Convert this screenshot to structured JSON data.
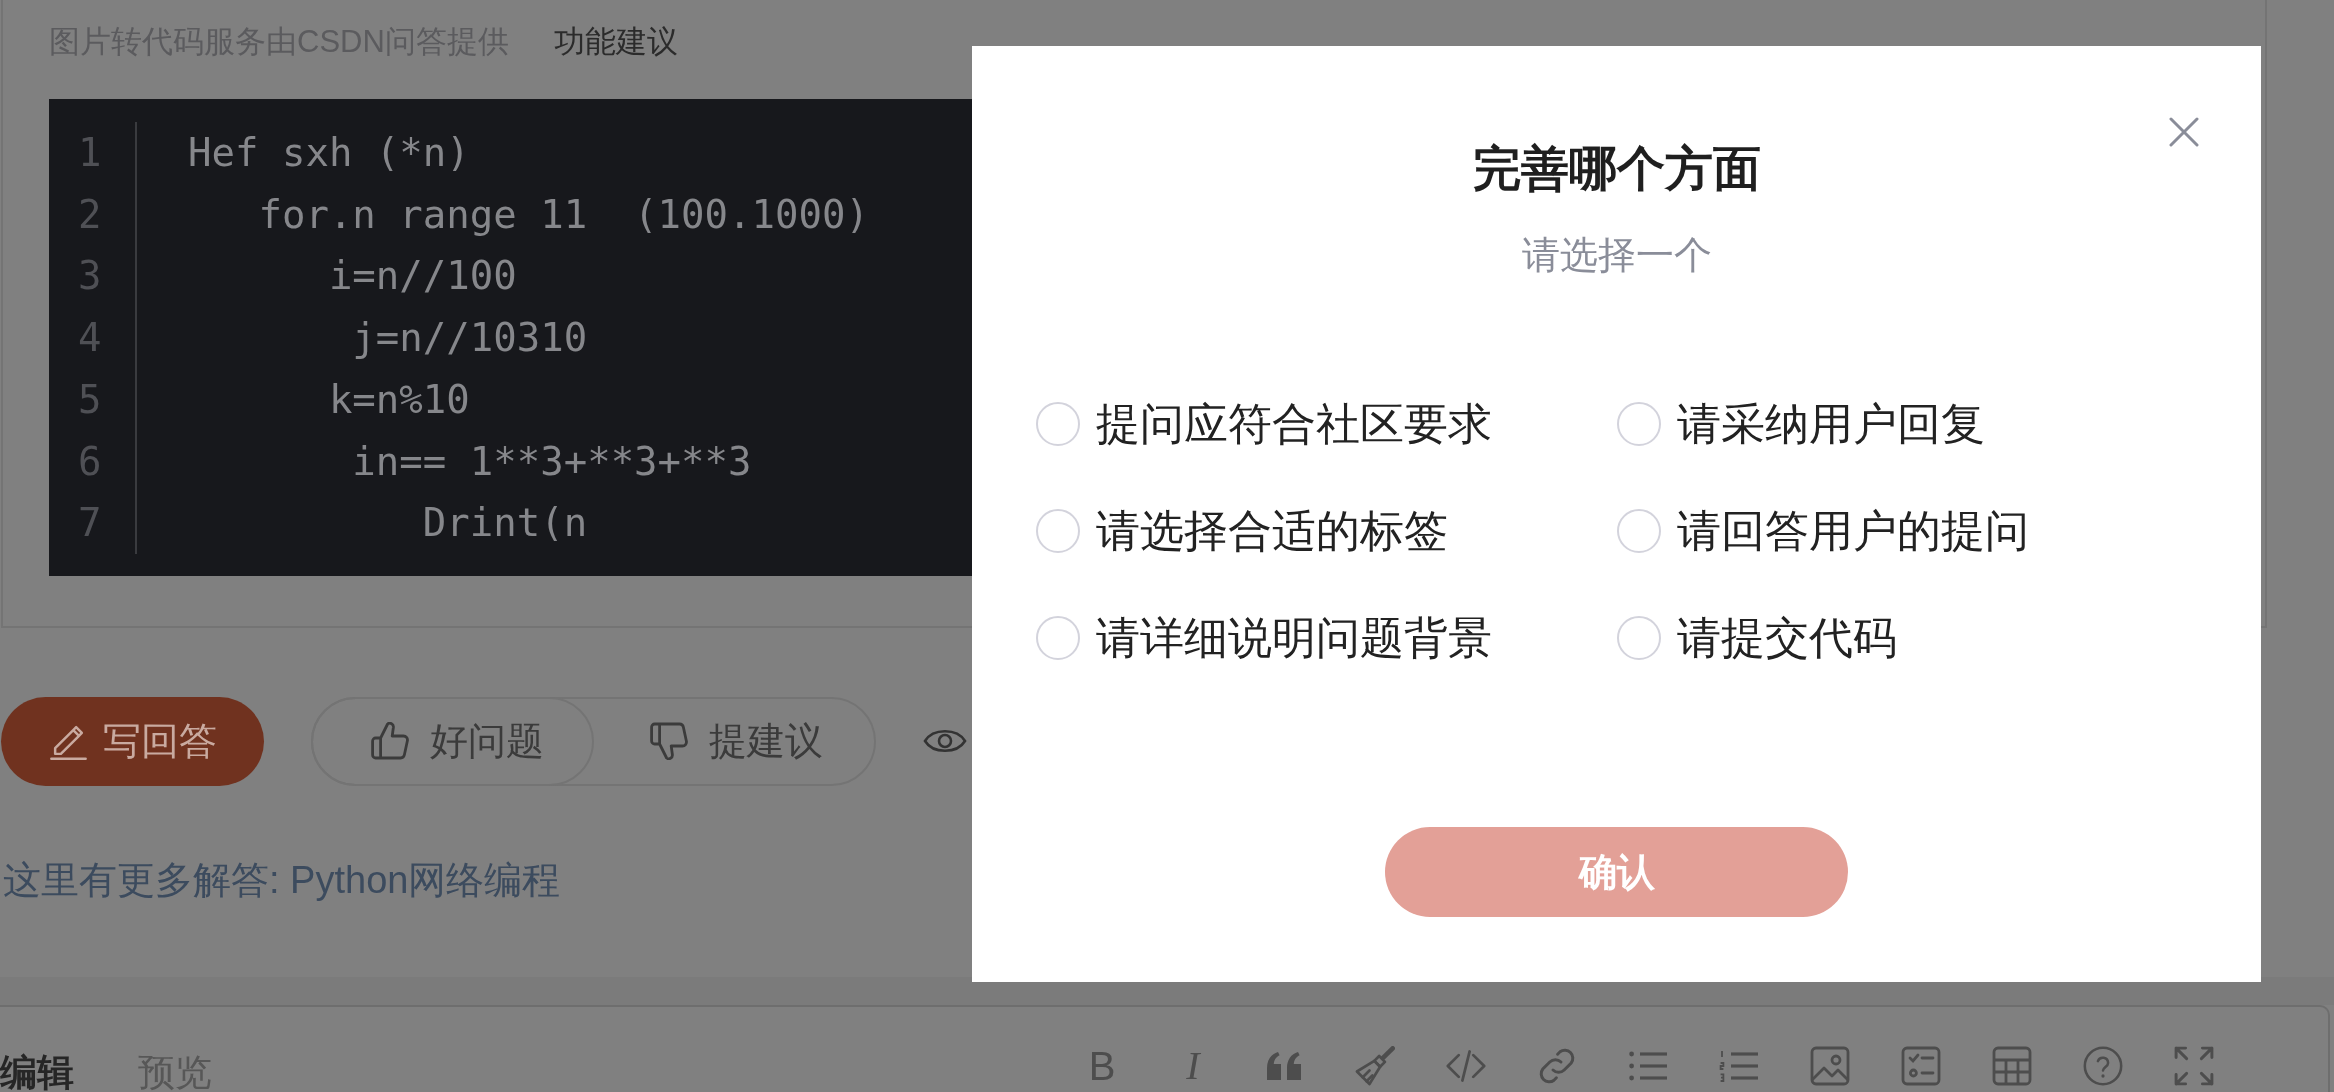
{
  "question": {
    "notice": {
      "text": "图片转代码服务由CSDN问答提供",
      "link": "功能建议"
    },
    "code_lines": [
      {
        "number": "1",
        "code": "Hef sxh (*n)"
      },
      {
        "number": "2",
        "code": "   for.n range 11  (100.1000)"
      },
      {
        "number": "3",
        "code": "      i=n//100"
      },
      {
        "number": "4",
        "code": "       j=n//10310"
      },
      {
        "number": "5",
        "code": "      k=n%10"
      },
      {
        "number": "6",
        "code": "       in== 1**3+**3+**3"
      },
      {
        "number": "7",
        "code": "          Drint(n"
      }
    ]
  },
  "actions": {
    "answer_button": "写回答",
    "votes": [
      {
        "kind": "upvote",
        "label": "好问题"
      },
      {
        "kind": "downvote",
        "label": "提建议"
      }
    ]
  },
  "more_answers": "这里有更多解答: Python网络编程",
  "editor": {
    "tabs": [
      {
        "label": "编辑",
        "selected": true
      },
      {
        "label": "预览",
        "selected": false
      }
    ],
    "toolbar_letters": [
      {
        "kind": "bold",
        "label": "B"
      },
      {
        "kind": "italic",
        "label": "I"
      }
    ]
  },
  "dialog": {
    "title": "完善哪个方面",
    "subtitle": "请选择一个",
    "options": [
      {
        "label": "提问应符合社区要求",
        "selected": false
      },
      {
        "label": "请采纳用户回复",
        "selected": false
      },
      {
        "label": "请选择合适的标签",
        "selected": false
      },
      {
        "label": "请回答用户的提问",
        "selected": false
      },
      {
        "label": "请详细说明问题背景",
        "selected": false
      },
      {
        "label": "请提交代码",
        "selected": false
      }
    ],
    "confirm": {
      "label": "确认",
      "disabled": true
    }
  }
}
